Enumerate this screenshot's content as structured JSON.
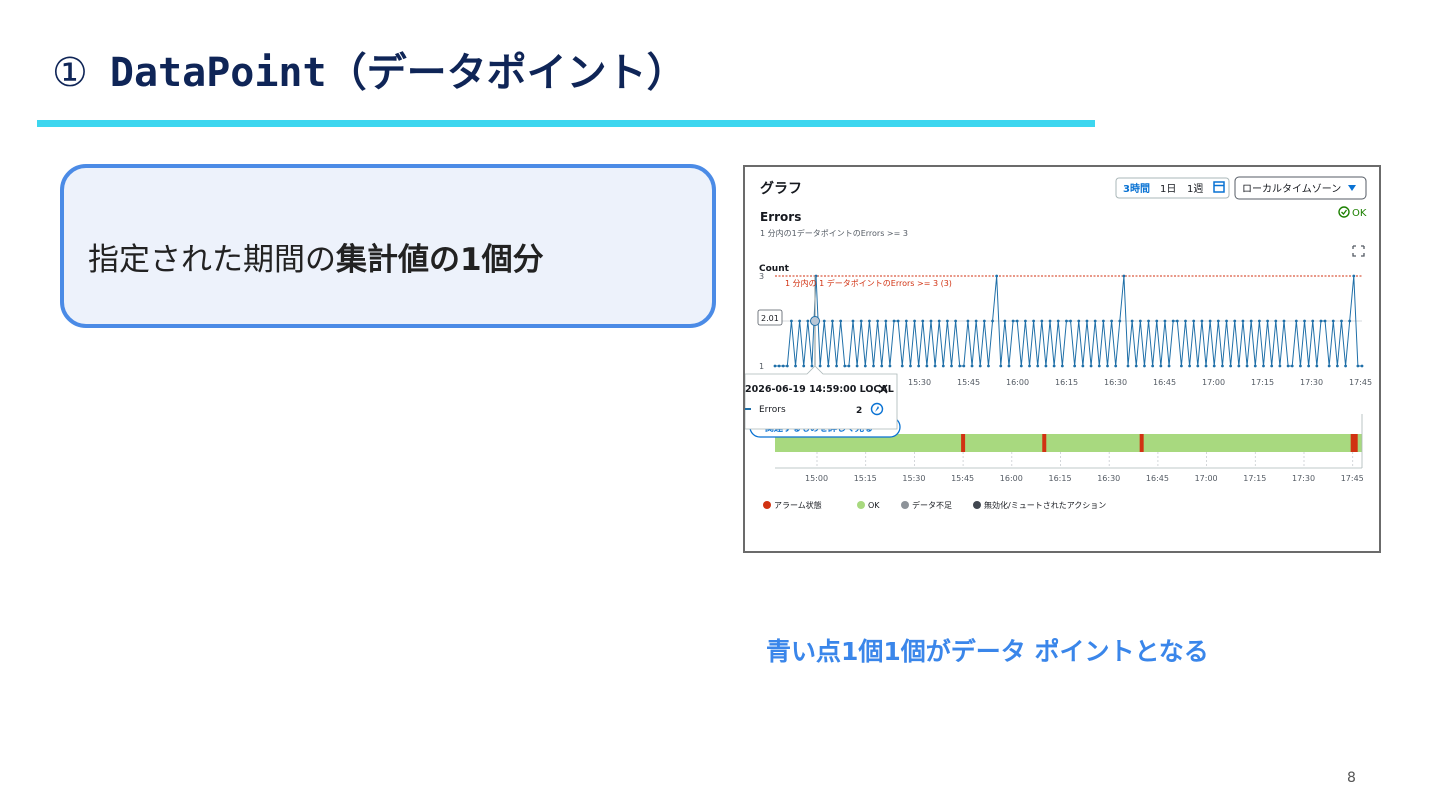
{
  "slide": {
    "title_num": "①",
    "title_text": "DataPoint（データポイント）",
    "callout_plain": "指定された期間の",
    "callout_bold": "集計値の1個分",
    "caption": "青い点1個1個がデータ ポイントとなる",
    "page_number": "8",
    "accent_color": "#3dd6ef",
    "callout_border_color": "#4b8be6",
    "caption_color": "#3a86ea"
  },
  "screenshot": {
    "panel_title": "グラフ",
    "range_buttons": [
      "3時間",
      "1日",
      "1週"
    ],
    "range_selected": "3時間",
    "calendar_icon": "calendar-icon",
    "timezone_select": "ローカルタイムゾーン",
    "metric_title": "Errors",
    "metric_subtitle": "1 分内の1データポイントのErrors >= 3",
    "status": "OK",
    "y_label": "Count",
    "threshold_label": "1 分内の 1 データポイントのErrors >= 3 (3)",
    "hover_value_label": "2.01",
    "tooltip": {
      "timestamp": "2026-06-19 14:59:00 LOCAL",
      "metric": "Errors",
      "value": "2"
    },
    "related_button": "関連するものを詳しく見る",
    "legend": [
      {
        "label": "アラーム状態",
        "color": "#d13212"
      },
      {
        "label": "OK",
        "color": "#a8d97f"
      },
      {
        "label": "データ不足",
        "color": "#8d9399"
      },
      {
        "label": "無効化/ミュートされたアクション",
        "color": "#414750"
      }
    ]
  },
  "chart_data": [
    {
      "type": "line",
      "title": "Errors",
      "ylabel": "Count",
      "ylim": [
        1,
        3
      ],
      "yticks": [
        "1",
        "3"
      ],
      "x_ticks": [
        "15:30",
        "15:45",
        "16:00",
        "16:15",
        "16:30",
        "16:45",
        "17:00",
        "17:15",
        "17:30",
        "17:45"
      ],
      "threshold": 3,
      "series": [
        {
          "name": "Errors",
          "color": "#1f6fa8",
          "values": [
            1,
            1,
            1,
            1,
            2,
            1,
            2,
            1,
            2,
            1,
            3,
            1,
            2,
            1,
            2,
            1,
            2,
            1,
            1,
            2,
            1,
            2,
            1,
            2,
            1,
            2,
            1,
            2,
            1,
            2,
            2,
            1,
            2,
            1,
            2,
            1,
            2,
            1,
            2,
            1,
            2,
            1,
            2,
            1,
            2,
            1,
            1,
            2,
            1,
            2,
            1,
            2,
            1,
            2,
            3,
            1,
            2,
            1,
            2,
            2,
            1,
            2,
            1,
            2,
            1,
            2,
            1,
            2,
            1,
            2,
            1,
            2,
            2,
            1,
            2,
            1,
            2,
            1,
            2,
            1,
            2,
            1,
            2,
            1,
            2,
            3,
            1,
            2,
            1,
            2,
            1,
            2,
            1,
            2,
            1,
            2,
            1,
            2,
            2,
            1,
            2,
            1,
            2,
            1,
            2,
            1,
            2,
            1,
            2,
            1,
            2,
            1,
            2,
            1,
            2,
            1,
            2,
            1,
            2,
            1,
            2,
            1,
            2,
            1,
            2,
            1,
            1,
            2,
            1,
            2,
            1,
            2,
            1,
            2,
            2,
            1,
            2,
            1,
            2,
            1,
            2,
            3,
            1,
            1
          ]
        }
      ]
    },
    {
      "type": "area",
      "title": "",
      "x_ticks": [
        "15:00",
        "15:15",
        "15:30",
        "15:45",
        "16:00",
        "16:15",
        "16:30",
        "16:45",
        "17:00",
        "17:15",
        "17:30",
        "17:45"
      ],
      "series": [
        {
          "name": "OK",
          "state_color": "#a8d97f",
          "alarm_markers_time": [
            "15:45",
            "16:10",
            "16:40",
            "17:45"
          ]
        }
      ]
    }
  ]
}
